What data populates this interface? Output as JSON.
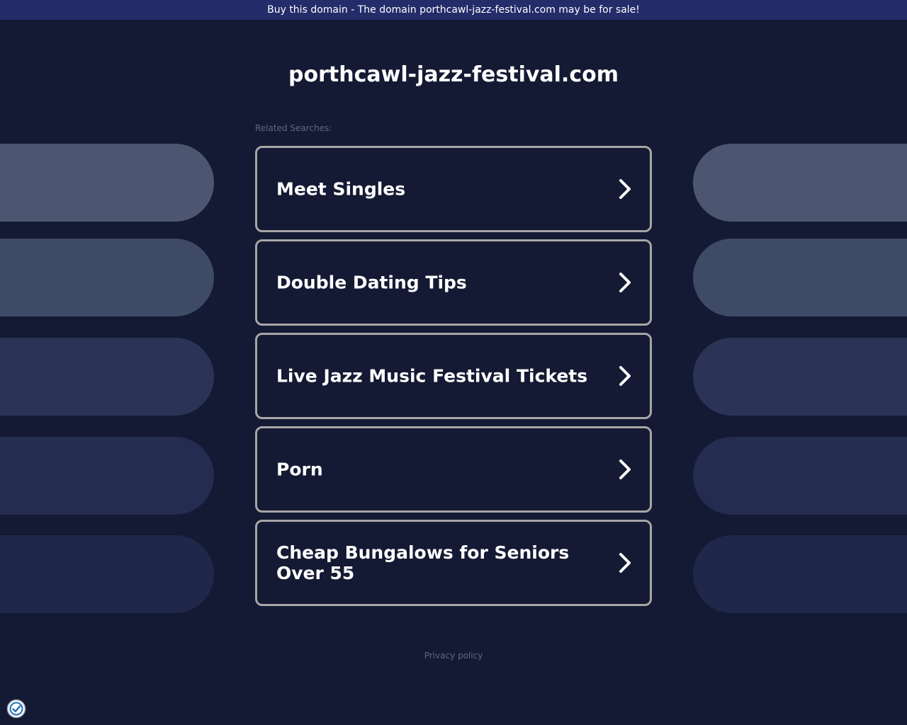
{
  "banner": {
    "text": "Buy this domain - The domain porthcawl-jazz-festival.com may be for sale!"
  },
  "header": {
    "domain": "porthcawl-jazz-festival.com"
  },
  "related": {
    "label": "Related Searches:",
    "items": [
      {
        "label": "Meet Singles",
        "icon": "chevron-right-icon"
      },
      {
        "label": "Double Dating Tips",
        "icon": "chevron-right-icon"
      },
      {
        "label": "Live Jazz Music Festival Tickets",
        "icon": "chevron-right-icon"
      },
      {
        "label": "Porn",
        "icon": "chevron-right-icon"
      },
      {
        "label": "Cheap Bungalows for Seniors Over 55",
        "icon": "chevron-right-icon"
      }
    ]
  },
  "footer": {
    "privacy": "Privacy policy"
  },
  "consent": {
    "icon": "privacy-consent-badge-icon"
  },
  "colors": {
    "background": "#141a33",
    "banner": "#242c69",
    "box_border": "#a6a6a6",
    "muted_text": "#5f6687",
    "decor_pills": [
      "#4d5670",
      "#3f4a67",
      "#2b3456",
      "#242d51",
      "#1f284a"
    ]
  }
}
